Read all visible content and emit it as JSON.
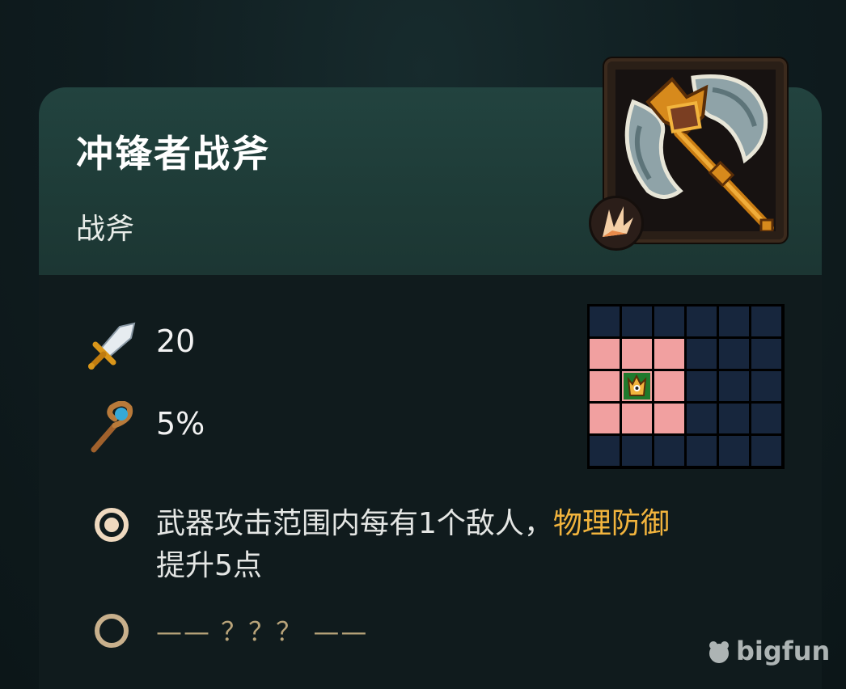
{
  "item": {
    "name": "冲锋者战斧",
    "type": "战斧",
    "portrait_icon": "battle-axe-icon",
    "skill_badge_icon": "burst-icon"
  },
  "stats": [
    {
      "icon": "sword-icon",
      "value": "20"
    },
    {
      "icon": "staff-icon",
      "value": "5%"
    }
  ],
  "attack_range": {
    "columns": 6,
    "rows": 5,
    "origin": [
      1,
      2
    ],
    "highlighted": [
      [
        0,
        1
      ],
      [
        1,
        1
      ],
      [
        2,
        1
      ],
      [
        0,
        2
      ],
      [
        2,
        2
      ],
      [
        0,
        3
      ],
      [
        1,
        3
      ],
      [
        2,
        3
      ]
    ],
    "colors": {
      "empty": "#17263d",
      "highlight": "#f1a0a0",
      "origin": "#1f7a2c"
    }
  },
  "effects": [
    {
      "icon": "unlocked-ring-icon",
      "text_before": "武器攻击范围内每有1个敌人，",
      "highlight": "物理防御",
      "text_after": "提升5点",
      "highlight_color": "#f2b43d"
    },
    {
      "icon": "locked-ring-icon",
      "text": "—— ？？？ ——"
    }
  ],
  "watermark": "bigfun"
}
